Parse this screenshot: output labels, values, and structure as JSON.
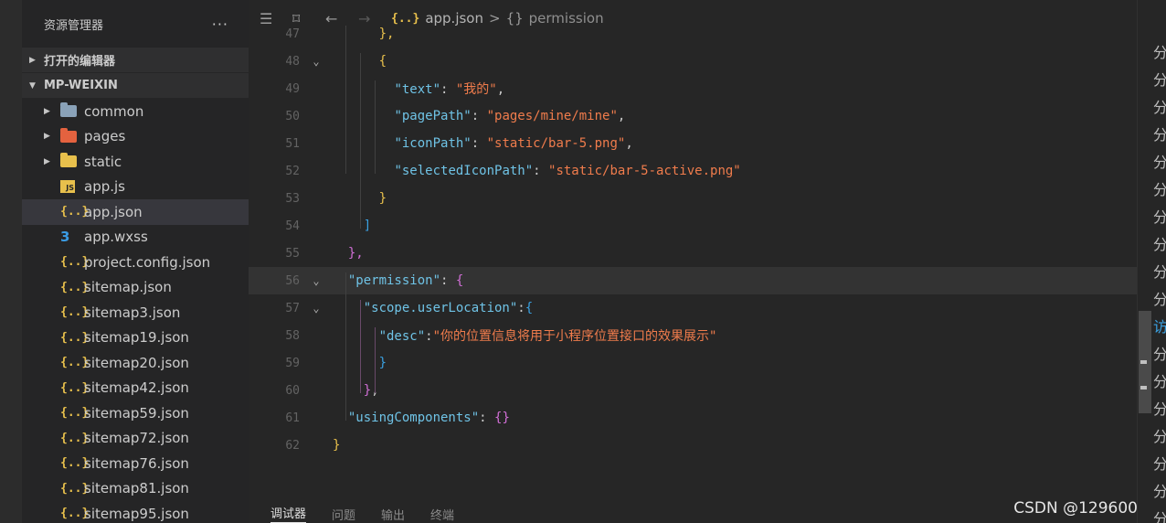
{
  "sidebar": {
    "title": "资源管理器",
    "more": "···",
    "sections": [
      {
        "label": "打开的编辑器",
        "expanded": false
      },
      {
        "label": "MP-WEIXIN",
        "expanded": true
      }
    ],
    "items": [
      {
        "label": "common",
        "kind": "folder",
        "icon": "folder-icon",
        "color": "#8aa2b8"
      },
      {
        "label": "pages",
        "kind": "folder",
        "icon": "pages-folder-icon",
        "color": "#e4623f"
      },
      {
        "label": "static",
        "kind": "folder",
        "icon": "static-folder-icon",
        "color": "#e8c04c"
      },
      {
        "label": "app.js",
        "kind": "js",
        "icon": "js-icon",
        "glyph": "JS"
      },
      {
        "label": "app.json",
        "kind": "json",
        "icon": "json-icon",
        "glyph": "{..}",
        "selected": true
      },
      {
        "label": "app.wxss",
        "kind": "css",
        "icon": "css-icon",
        "glyph": "3"
      },
      {
        "label": "project.config.json",
        "kind": "json",
        "icon": "json-icon",
        "glyph": "{..}"
      },
      {
        "label": "sitemap.json",
        "kind": "json",
        "icon": "json-icon",
        "glyph": "{..}"
      },
      {
        "label": "sitemap3.json",
        "kind": "json",
        "icon": "json-icon",
        "glyph": "{..}"
      },
      {
        "label": "sitemap19.json",
        "kind": "json",
        "icon": "json-icon",
        "glyph": "{..}"
      },
      {
        "label": "sitemap20.json",
        "kind": "json",
        "icon": "json-icon",
        "glyph": "{..}"
      },
      {
        "label": "sitemap42.json",
        "kind": "json",
        "icon": "json-icon",
        "glyph": "{..}"
      },
      {
        "label": "sitemap59.json",
        "kind": "json",
        "icon": "json-icon",
        "glyph": "{..}"
      },
      {
        "label": "sitemap72.json",
        "kind": "json",
        "icon": "json-icon",
        "glyph": "{..}"
      },
      {
        "label": "sitemap76.json",
        "kind": "json",
        "icon": "json-icon",
        "glyph": "{..}"
      },
      {
        "label": "sitemap81.json",
        "kind": "json",
        "icon": "json-icon",
        "glyph": "{..}"
      },
      {
        "label": "sitemap95.json",
        "kind": "json",
        "icon": "json-icon",
        "glyph": "{..}"
      }
    ]
  },
  "breadcrumb": {
    "json_glyph": "{..}",
    "file": "app.json",
    "separator": ">",
    "object_glyph": "{}",
    "symbol": "permission"
  },
  "toolbar": {
    "list_glyph": "☰",
    "bookmark_glyph": "⌑",
    "back_glyph": "←",
    "forward_glyph": "→"
  },
  "code_lines": [
    {
      "n": "47",
      "fold": "",
      "tokens": [
        [
          "      ",
          "p"
        ],
        [
          "},",
          "b1"
        ]
      ]
    },
    {
      "n": "48",
      "fold": "⌄",
      "tokens": [
        [
          "      ",
          "p"
        ],
        [
          "{",
          "b1"
        ]
      ]
    },
    {
      "n": "49",
      "fold": "",
      "tokens": [
        [
          "        ",
          "p"
        ],
        [
          "\"text\"",
          "k"
        ],
        [
          ": ",
          "p"
        ],
        [
          "\"我的\"",
          "s"
        ],
        [
          ",",
          "p"
        ]
      ]
    },
    {
      "n": "50",
      "fold": "",
      "tokens": [
        [
          "        ",
          "p"
        ],
        [
          "\"pagePath\"",
          "k"
        ],
        [
          ": ",
          "p"
        ],
        [
          "\"pages/mine/mine\"",
          "s"
        ],
        [
          ",",
          "p"
        ]
      ]
    },
    {
      "n": "51",
      "fold": "",
      "tokens": [
        [
          "        ",
          "p"
        ],
        [
          "\"iconPath\"",
          "k"
        ],
        [
          ": ",
          "p"
        ],
        [
          "\"static/bar-5.png\"",
          "s"
        ],
        [
          ",",
          "p"
        ]
      ]
    },
    {
      "n": "52",
      "fold": "",
      "tokens": [
        [
          "        ",
          "p"
        ],
        [
          "\"selectedIconPath\"",
          "k"
        ],
        [
          ": ",
          "p"
        ],
        [
          "\"static/bar-5-active.png\"",
          "s"
        ]
      ]
    },
    {
      "n": "53",
      "fold": "",
      "tokens": [
        [
          "      ",
          "p"
        ],
        [
          "}",
          "b1"
        ]
      ]
    },
    {
      "n": "54",
      "fold": "",
      "tokens": [
        [
          "    ",
          "p"
        ],
        [
          "]",
          "b3"
        ]
      ]
    },
    {
      "n": "55",
      "fold": "",
      "tokens": [
        [
          "  ",
          "p"
        ],
        [
          "},",
          "b2"
        ]
      ]
    },
    {
      "n": "56",
      "fold": "⌄",
      "cur": true,
      "tokens": [
        [
          "  ",
          "p"
        ],
        [
          "\"permission\"",
          "k"
        ],
        [
          ": ",
          "p"
        ],
        [
          "{",
          "b2"
        ]
      ]
    },
    {
      "n": "57",
      "fold": "⌄",
      "tokens": [
        [
          "    ",
          "p"
        ],
        [
          "\"scope.userLocation\"",
          "k"
        ],
        [
          ":",
          "p"
        ],
        [
          "{",
          "b3"
        ]
      ]
    },
    {
      "n": "58",
      "fold": "",
      "tokens": [
        [
          "      ",
          "p"
        ],
        [
          "\"desc\"",
          "k"
        ],
        [
          ":",
          "p"
        ],
        [
          "\"你的位置信息将用于小程序位置接口的效果展示\"",
          "s"
        ]
      ]
    },
    {
      "n": "59",
      "fold": "",
      "tokens": [
        [
          "      ",
          "p"
        ],
        [
          "}",
          "b3"
        ]
      ]
    },
    {
      "n": "60",
      "fold": "",
      "tokens": [
        [
          "    ",
          "p"
        ],
        [
          "}",
          "b2"
        ],
        [
          ",",
          "p"
        ]
      ]
    },
    {
      "n": "61",
      "fold": "",
      "tokens": [
        [
          "  ",
          "p"
        ],
        [
          "\"usingComponents\"",
          "k"
        ],
        [
          ": ",
          "p"
        ],
        [
          "{}",
          "b2"
        ]
      ]
    },
    {
      "n": "62",
      "fold": "",
      "tokens": [
        [
          "",
          "p"
        ],
        [
          "}",
          "b1"
        ]
      ]
    }
  ],
  "panel_tabs": [
    {
      "label": "调试器",
      "active": true
    },
    {
      "label": "问题"
    },
    {
      "label": "输出"
    },
    {
      "label": "终端"
    }
  ],
  "panel_icons": "⌃  ✕",
  "watermark": "CSDN @129600年",
  "right_strip": [
    "分",
    "分",
    "分",
    "分",
    "分",
    "分",
    "分",
    "分",
    "分",
    "分",
    "访",
    "分",
    "分",
    "分",
    "分",
    "分",
    "分",
    "分"
  ],
  "colors": {
    "json_icon": "#e8c04c",
    "css_icon": "#3b9be3",
    "key": "#6fc3e6",
    "string": "#f07c4c",
    "bracket_level1": "#e8c04c",
    "bracket_level2": "#d16fd6",
    "bracket_level3": "#3aa0e0"
  }
}
